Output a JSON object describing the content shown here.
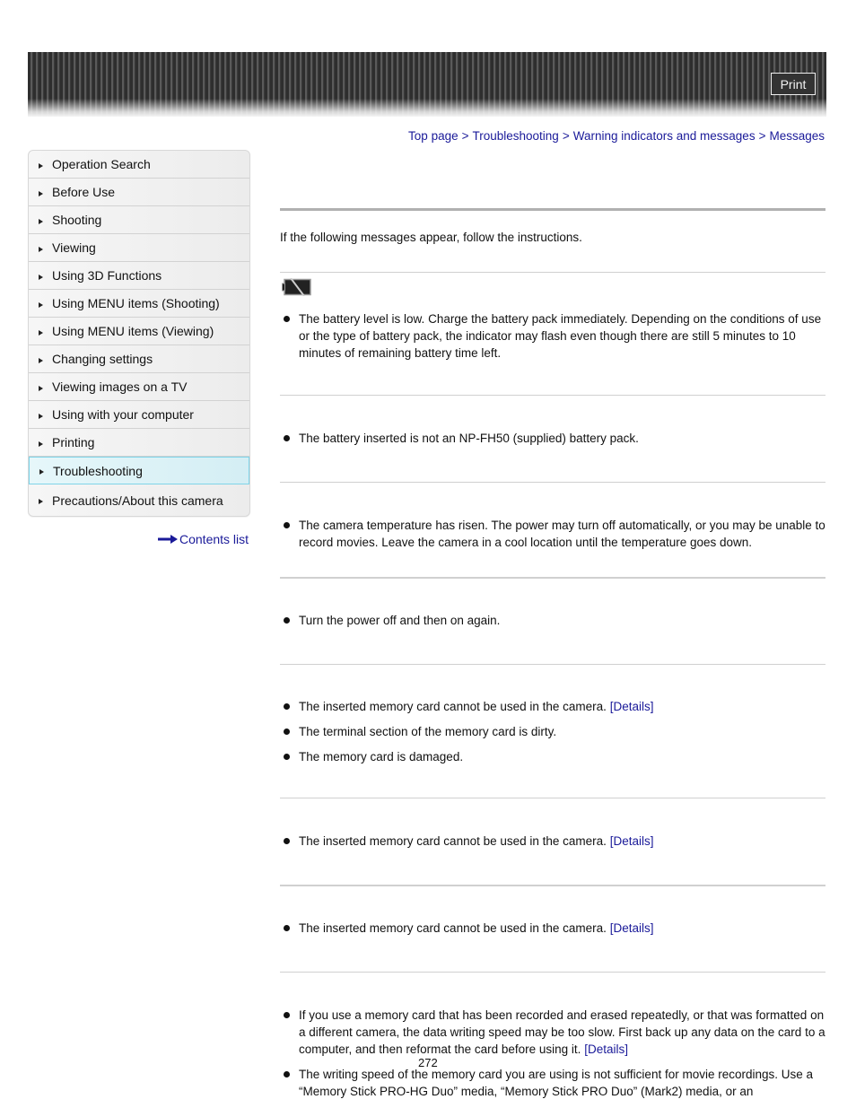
{
  "header": {
    "print_label": "Print"
  },
  "breadcrumb": [
    {
      "label": "Top page"
    },
    {
      "label": "Troubleshooting"
    },
    {
      "label": "Warning indicators and messages"
    },
    {
      "label": "Messages"
    }
  ],
  "breadcrumb_separator": ">",
  "sidebar": {
    "items": [
      {
        "label": "Operation Search",
        "active": false
      },
      {
        "label": "Before Use",
        "active": false
      },
      {
        "label": "Shooting",
        "active": false
      },
      {
        "label": "Viewing",
        "active": false
      },
      {
        "label": "Using 3D Functions",
        "active": false
      },
      {
        "label": "Using MENU items (Shooting)",
        "active": false
      },
      {
        "label": "Using MENU items (Viewing)",
        "active": false
      },
      {
        "label": "Changing settings",
        "active": false
      },
      {
        "label": "Viewing images on a TV",
        "active": false
      },
      {
        "label": "Using with your computer",
        "active": false
      },
      {
        "label": "Printing",
        "active": false
      },
      {
        "label": "Troubleshooting",
        "active": true
      },
      {
        "label": "Precautions/About this camera",
        "active": false
      }
    ],
    "contents_list_label": "Contents list"
  },
  "main": {
    "intro": "If the following messages appear, follow the instructions.",
    "sections": [
      {
        "icon": "battery-low-icon",
        "items": [
          {
            "text": "The battery level is low. Charge the battery pack immediately. Depending on the conditions of use or the type of battery pack, the indicator may flash even though there are still 5 minutes to 10 minutes of remaining battery time left."
          }
        ]
      },
      {
        "items": [
          {
            "text": "The battery inserted is not an NP-FH50 (supplied) battery pack."
          }
        ]
      },
      {
        "items": [
          {
            "text": "The camera temperature has risen. The power may turn off automatically, or you may be unable to record movies. Leave the camera in a cool location until the temperature goes down."
          }
        ]
      },
      {
        "items": [
          {
            "text": "Turn the power off and then on again."
          }
        ]
      },
      {
        "items": [
          {
            "text": "The inserted memory card cannot be used in the camera.",
            "link": "[Details]"
          },
          {
            "text": "The terminal section of the memory card is dirty."
          },
          {
            "text": "The memory card is damaged."
          }
        ]
      },
      {
        "items": [
          {
            "text": "The inserted memory card cannot be used in the camera.",
            "link": "[Details]"
          }
        ]
      },
      {
        "items": [
          {
            "text": "The inserted memory card cannot be used in the camera.",
            "link": "[Details]"
          }
        ]
      },
      {
        "items": [
          {
            "text": "If you use a memory card that has been recorded and erased repeatedly, or that was formatted on a different camera, the data writing speed may be too slow. First back up any data on the card to a computer, and then reformat the card before using it.",
            "link": "[Details]"
          },
          {
            "text": "The writing speed of the memory card you are using is not sufficient for movie recordings. Use a “Memory Stick PRO-HG Duo” media, “Memory Stick PRO Duo” (Mark2) media, or an"
          }
        ]
      }
    ]
  },
  "footer": {
    "page_number": "272"
  }
}
